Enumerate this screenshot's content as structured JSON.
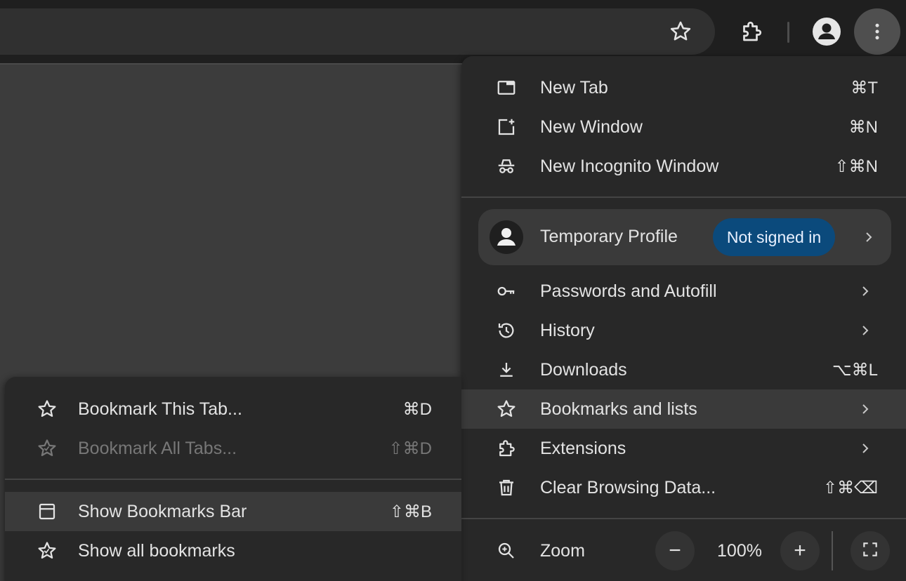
{
  "main_menu": {
    "new_tab": {
      "label": "New Tab",
      "shortcut": "⌘T"
    },
    "new_window": {
      "label": "New Window",
      "shortcut": "⌘N"
    },
    "new_incognito": {
      "label": "New Incognito Window",
      "shortcut": "⇧⌘N"
    },
    "profile": {
      "label": "Temporary Profile",
      "badge": "Not signed in"
    },
    "passwords": {
      "label": "Passwords and Autofill"
    },
    "history": {
      "label": "History"
    },
    "downloads": {
      "label": "Downloads",
      "shortcut": "⌥⌘L"
    },
    "bookmarks": {
      "label": "Bookmarks and lists"
    },
    "extensions": {
      "label": "Extensions"
    },
    "clear_data": {
      "label": "Clear Browsing Data...",
      "shortcut": "⇧⌘⌫"
    },
    "zoom": {
      "label": "Zoom",
      "value": "100%",
      "minus": "−",
      "plus": "+"
    }
  },
  "bookmarks_submenu": {
    "bookmark_tab": {
      "label": "Bookmark This Tab...",
      "shortcut": "⌘D"
    },
    "bookmark_all": {
      "label": "Bookmark All Tabs...",
      "shortcut": "⇧⌘D"
    },
    "show_bar": {
      "label": "Show Bookmarks Bar",
      "shortcut": "⇧⌘B"
    },
    "show_all": {
      "label": "Show all bookmarks"
    }
  },
  "icons": {
    "toolbar": [
      "star-icon",
      "extensions-icon",
      "profile-icon",
      "more-vert-icon"
    ]
  },
  "colors": {
    "menu_bg": "#282828",
    "toolbar_bg": "#1f1f1f",
    "badge_bg": "#0b4a7c",
    "hover_bg": "#3a3a3a"
  }
}
